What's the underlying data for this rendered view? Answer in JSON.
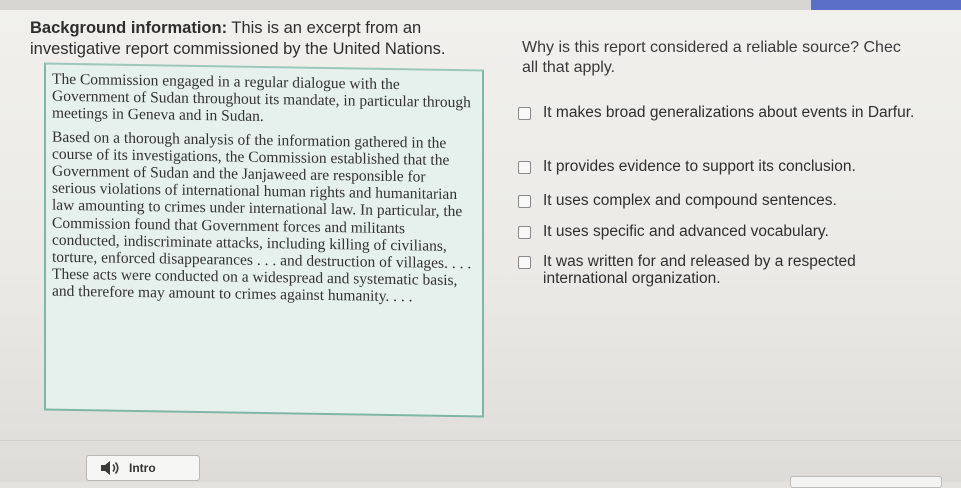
{
  "background": {
    "label": "Background information:",
    "text": " This is an excerpt from an investigative report commissioned by the United Nations."
  },
  "excerpt": {
    "paragraphs": [
      "The Commission engaged in a regular dialogue with the Government of Sudan throughout its mandate, in particular through meetings in Geneva and in Sudan.",
      "Based on a thorough analysis of the information gathered in the course of its investigations, the Commission established that the Government of Sudan and the Janjaweed are responsible for serious violations of international human rights and humanitarian law amounting to crimes under international law. In particular, the Commission found that Government forces and militants conducted, indiscriminate attacks, including killing of civilians, torture, enforced disappearances . . . and destruction of villages. . . . These acts were conducted on a widespread and systematic basis, and therefore may amount to crimes against humanity. . . ."
    ]
  },
  "question": {
    "text": "Why is this report considered a reliable source? Chec\nall that apply."
  },
  "options": [
    "It makes broad generalizations about events in Darfur.",
    "It provides evidence to support its conclusion.",
    "It uses complex and compound sentences.",
    "It uses specific and advanced vocabulary.",
    "It was written for and released by a respected international organization."
  ],
  "footer": {
    "intro_label": "Intro",
    "icon": "speaker-icon"
  },
  "colors": {
    "excerpt_bg": "#e6f0ec",
    "excerpt_border": "#7fb6a6",
    "accent": "#5b6fc9"
  }
}
